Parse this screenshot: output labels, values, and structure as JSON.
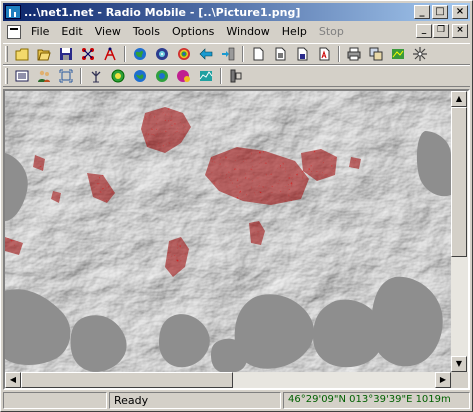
{
  "window": {
    "title": "...\\net1.net - Radio Mobile - [..\\Picture1.png]",
    "title_buttons": [
      "_",
      "□",
      "×"
    ]
  },
  "menu": {
    "items": [
      {
        "label": "File",
        "enabled": true
      },
      {
        "label": "Edit",
        "enabled": true
      },
      {
        "label": "View",
        "enabled": true
      },
      {
        "label": "Tools",
        "enabled": true
      },
      {
        "label": "Options",
        "enabled": true
      },
      {
        "label": "Window",
        "enabled": true
      },
      {
        "label": "Help",
        "enabled": true
      },
      {
        "label": "Stop",
        "enabled": false
      }
    ],
    "mdi_buttons": [
      "_",
      "❐",
      "×"
    ]
  },
  "toolbar1": {
    "icons": [
      "new-file-icon",
      "open-folder-icon",
      "save-icon",
      "network-properties-icon",
      "unit-properties-icon",
      "globe-icon",
      "cd-icon",
      "rainbow-icon",
      "arrow-left-icon",
      "arrow-right-door-icon",
      "new-picture-icon",
      "open-picture-icon",
      "save-picture-icon",
      "save-picture-as-icon",
      "print-icon",
      "merge-icon",
      "network-map-icon",
      "star-icon"
    ]
  },
  "toolbar2": {
    "icons": [
      "list-icon",
      "gamers-icon",
      "focus-icon",
      "antenna-icon",
      "radio-link-icon",
      "radio-coverage-icon",
      "visual-coverage-icon",
      "route-icon",
      "fresnel-icon",
      "antenna-pattern-icon"
    ]
  },
  "status": {
    "left": "",
    "message": "Ready",
    "coordinates": "46°29'09\"N 013°39'39\"E 1019m"
  },
  "colors": {
    "title_start": "#0a246a",
    "title_end": "#a6caf0",
    "coverage": "#c00000",
    "coords_text": "#006000"
  }
}
